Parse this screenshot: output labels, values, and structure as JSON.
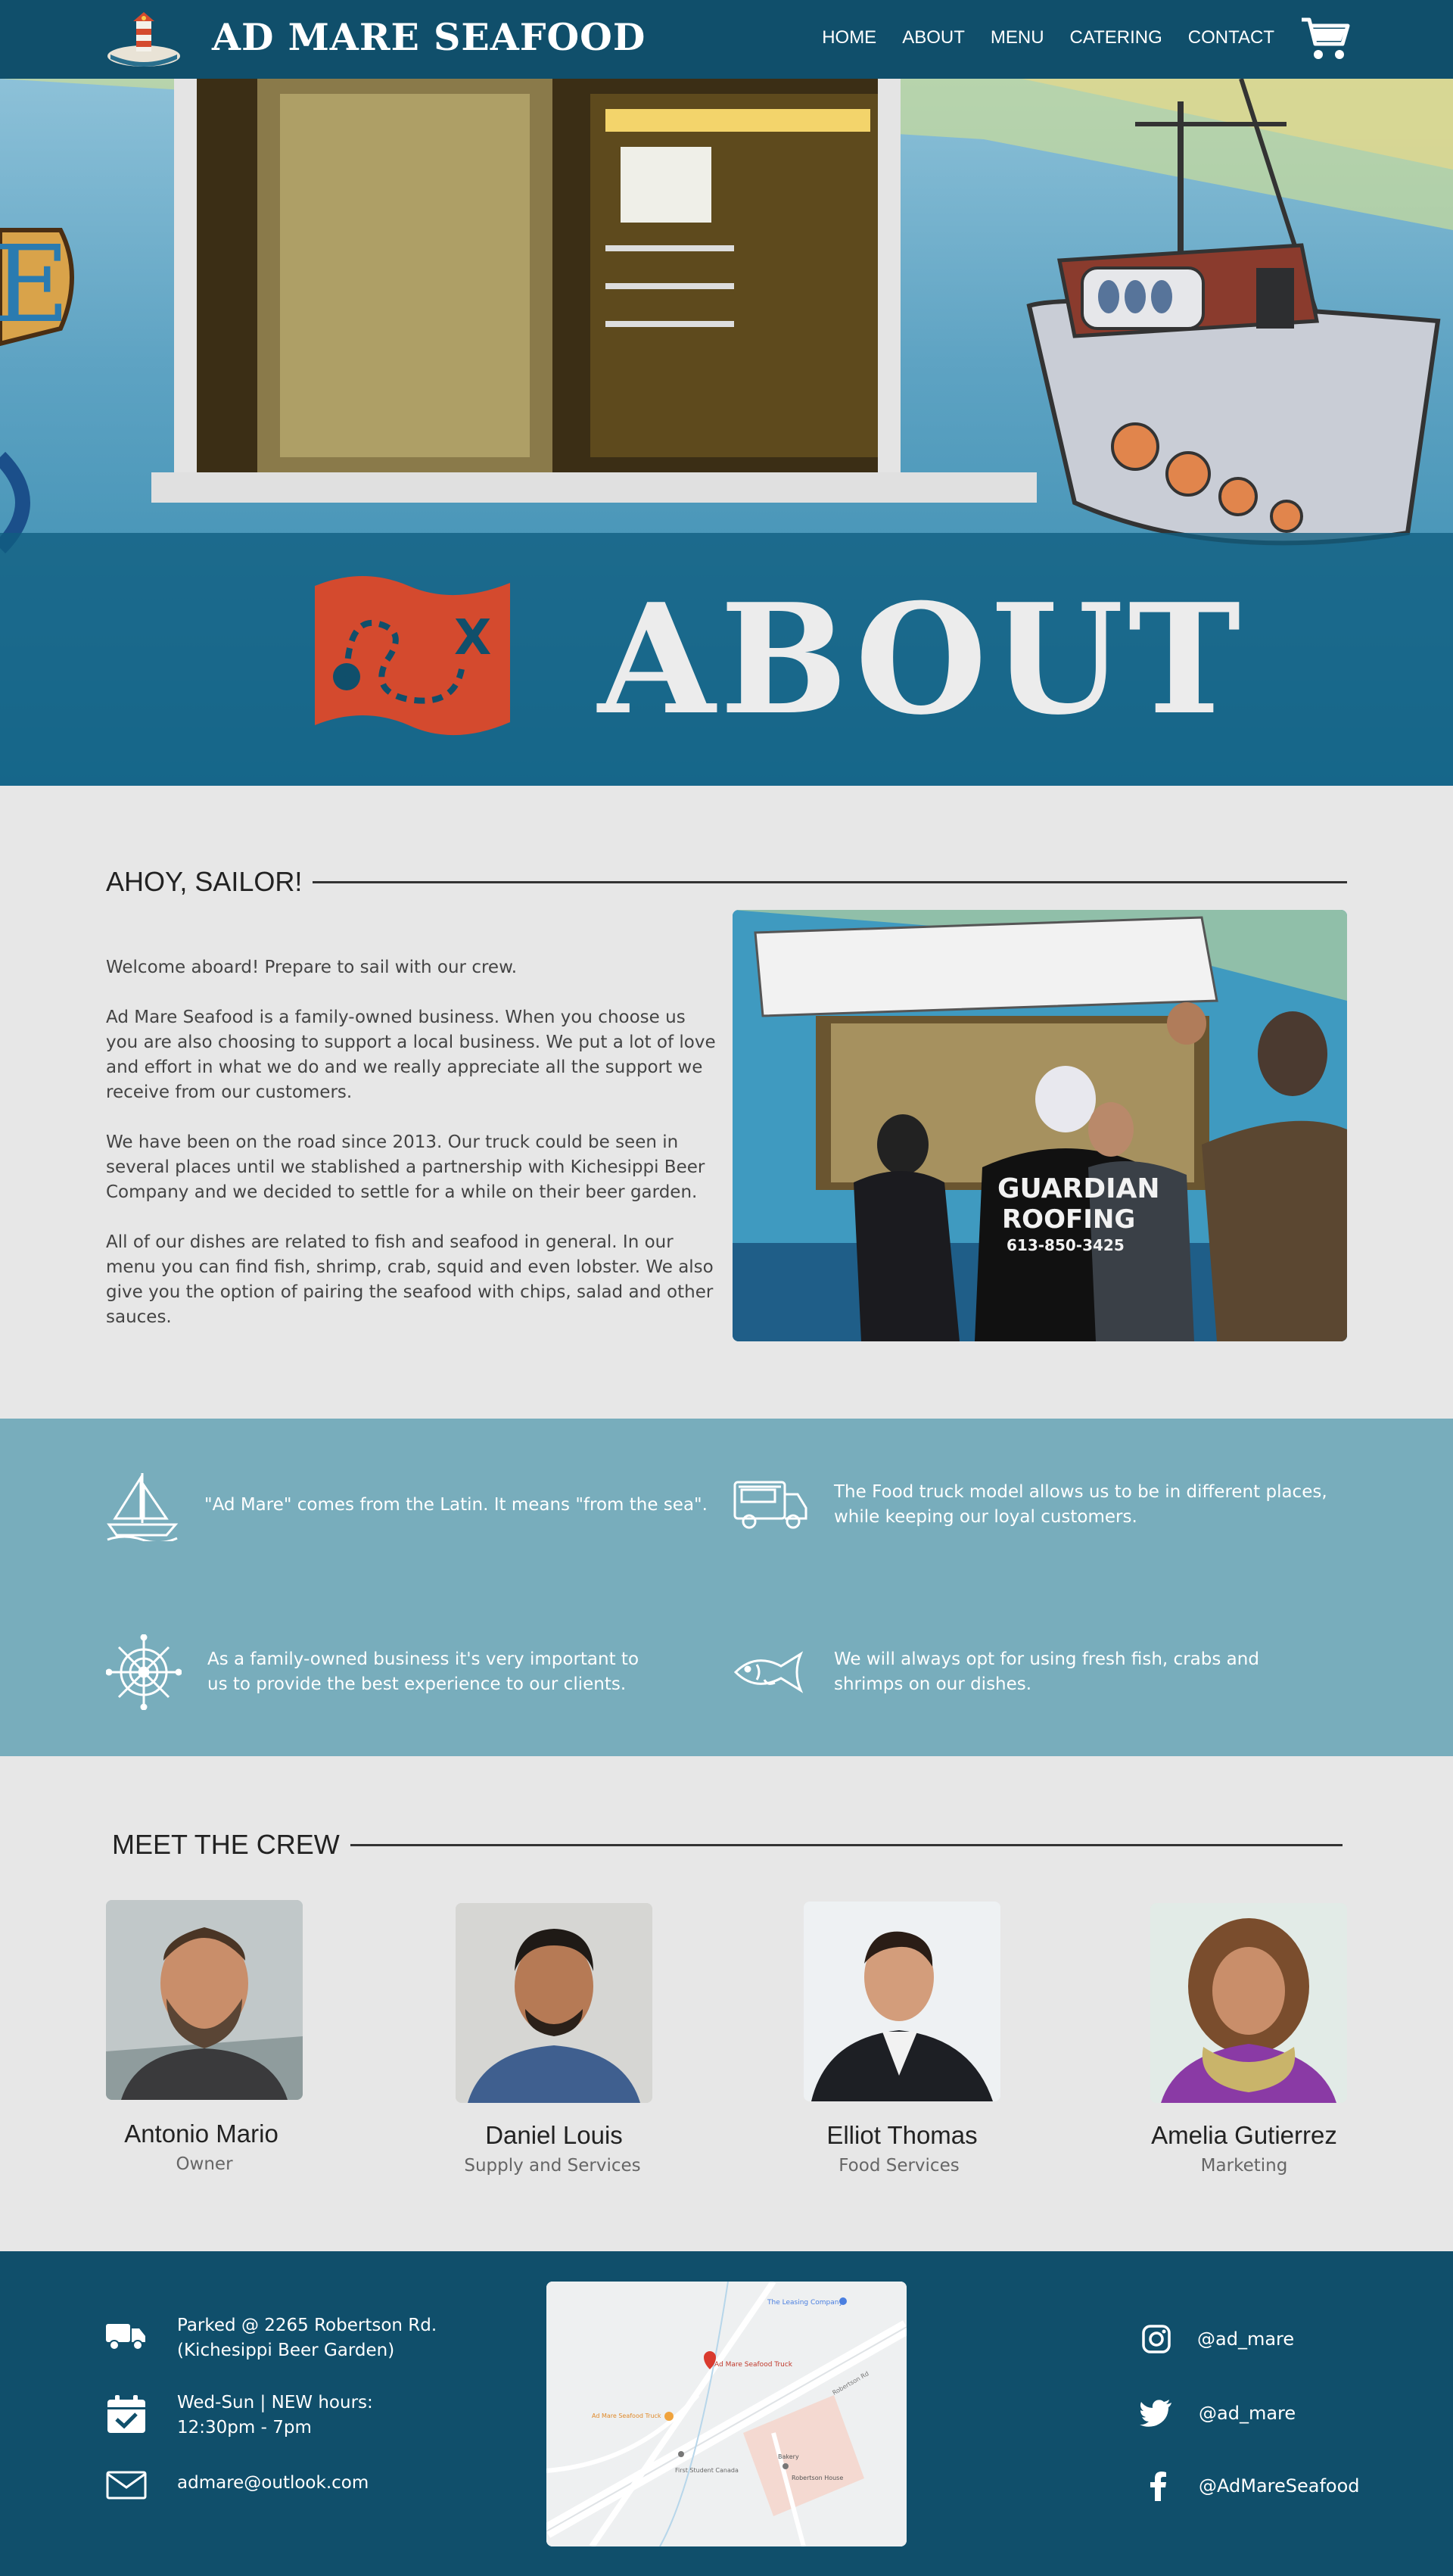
{
  "nav": {
    "brand": "AD MARE SEAFOOD",
    "links": [
      "HOME",
      "ABOUT",
      "MENU",
      "CATERING",
      "CONTACT"
    ]
  },
  "hero": {
    "title": "ABOUT"
  },
  "ahoy": {
    "title": "AHOY, SAILOR!",
    "paragraphs": [
      "Welcome aboard! Prepare to sail with our crew.",
      "Ad Mare Seafood is a family-owned business. When you choose us you are also choosing to support a local business. We put a lot of love and effort in what we do and we really appreciate all the support we receive from our customers.",
      "We have been on the road since 2013. Our truck could be seen in several places until we stablished a partnership with Kichesippi Beer Company and we decided to settle for a while on their beer garden.",
      "All of our dishes are related to fish and seafood in general. In our menu you can find fish, shrimp, crab, squid and even lobster. We also give you the option of pairing the seafood with chips, salad and other sauces."
    ],
    "photo_text": {
      "line1": "GUARDIAN",
      "line2": "ROOFING",
      "line3": "613-850-3425"
    }
  },
  "facts": [
    {
      "icon": "sailboat-icon",
      "text": "\"Ad Mare\" comes from the Latin. It means \"from the sea\"."
    },
    {
      "icon": "food-truck-icon",
      "text": "The Food truck model allows us to be in different places, while keeping our loyal customers."
    },
    {
      "icon": "ship-wheel-icon",
      "text": "As a family-owned business it's very important to us to provide the best experience to our clients."
    },
    {
      "icon": "fish-icon",
      "text": "We will always opt for using fresh fish, crabs and shrimps on our dishes."
    }
  ],
  "crew": {
    "title": "MEET THE CREW",
    "members": [
      {
        "name": "Antonio Mario",
        "role": "Owner"
      },
      {
        "name": "Daniel Louis",
        "role": "Supply and Services"
      },
      {
        "name": "Elliot Thomas",
        "role": "Food Services"
      },
      {
        "name": "Amelia Gutierrez",
        "role": "Marketing"
      }
    ]
  },
  "footer": {
    "address_line1": "Parked @ 2265 Robertson Rd.",
    "address_line2": "(Kichesippi Beer Garden)",
    "hours_line1": "Wed-Sun | NEW hours:",
    "hours_line2": "12:30pm - 7pm",
    "email": "admare@outlook.com",
    "map_labels": {
      "leasing": "The Leasing Company",
      "truck": "Ad Mare Seafood Truck",
      "truck2": "Ad Mare Seafood Truck",
      "first_student": "First Student Canada",
      "robertson": "Robertson House",
      "bakery": "Bakery",
      "road": "Robertson Rd"
    },
    "social": [
      {
        "icon": "instagram-icon",
        "handle": "@ad_mare"
      },
      {
        "icon": "twitter-icon",
        "handle": "@ad_mare"
      },
      {
        "icon": "facebook-icon",
        "handle": "@AdMareSeafood"
      }
    ]
  },
  "colors": {
    "navy": "#104f6b",
    "teal": "#78adbc",
    "red": "#d44a2e",
    "bg": "#e7e7e7"
  }
}
